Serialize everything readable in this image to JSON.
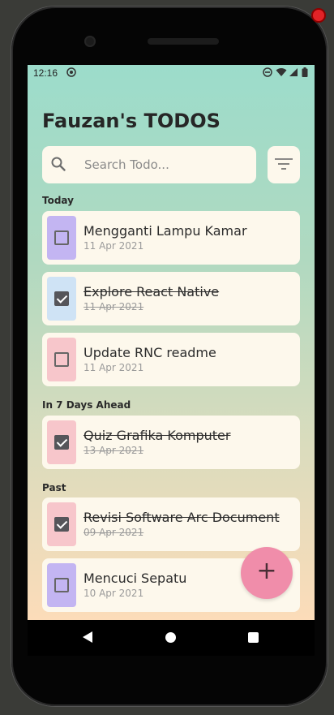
{
  "status_bar": {
    "time": "12:16"
  },
  "app": {
    "title": "Fauzan's TODOS"
  },
  "search": {
    "placeholder": "Search Todo..."
  },
  "sections": {
    "today": "Today",
    "ahead": "In 7 Days Ahead",
    "past": "Past"
  },
  "todos": [
    {
      "title": "Mengganti Lampu Kamar",
      "date": "11 Apr 2021",
      "done": false,
      "color": "#c3b5f2"
    },
    {
      "title": "Explore React Native",
      "date": "11 Apr 2021",
      "done": true,
      "color": "#cfe3f5"
    },
    {
      "title": "Update RNC readme",
      "date": "11 Apr 2021",
      "done": false,
      "color": "#f7c6cb"
    },
    {
      "title": "Quiz Grafika Komputer",
      "date": "13 Apr 2021",
      "done": true,
      "color": "#f7c6cb"
    },
    {
      "title": "Revisi Software Arc Document",
      "date": "09 Apr 2021",
      "done": true,
      "color": "#f7c6cb"
    },
    {
      "title": "Mencuci Sepatu",
      "date": "10 Apr 2021",
      "done": false,
      "color": "#c3b5f2"
    }
  ],
  "fab": {
    "label": "+",
    "color": "#f08daa"
  },
  "icons": {
    "search": "search-icon",
    "filter": "filter-icon",
    "add": "plus-icon"
  }
}
